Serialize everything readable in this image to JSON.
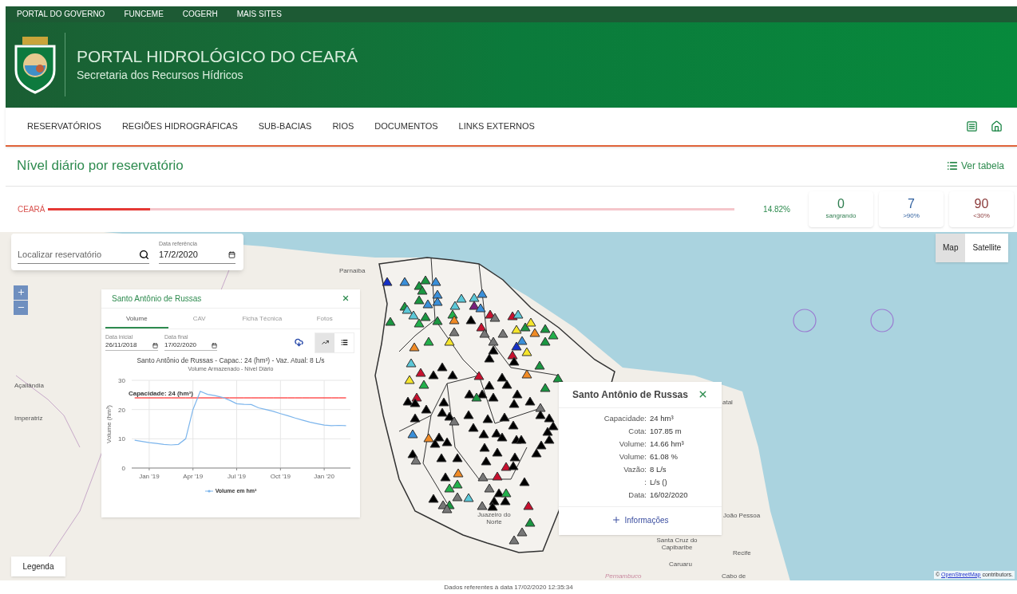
{
  "top_links": [
    "PORTAL DO GOVERNO",
    "FUNCEME",
    "COGERH",
    "MAIS SITES"
  ],
  "header": {
    "title": "PORTAL HIDROLÓGICO DO CEARÁ",
    "subtitle": "Secretaria dos Recursos Hídricos"
  },
  "nav": {
    "items": [
      "RESERVATÓRIOS",
      "REGIÕES HIDROGRÁFICAS",
      "SUB-BACIAS",
      "RIOS",
      "DOCUMENTOS",
      "LINKS EXTERNOS"
    ]
  },
  "page_title": "Nível diário por reservatório",
  "table_link": "Ver tabela",
  "summary": {
    "region": "CEARÁ",
    "level": 0.1482,
    "reading": "14.82%",
    "cards": [
      {
        "value": "0",
        "label": "sangrando",
        "color": "#2e7d4f"
      },
      {
        "value": "7",
        "label": ">90%",
        "color": "#2f5f9e"
      },
      {
        "value": "90",
        "label": "<30%",
        "color": "#8b3a3a"
      }
    ]
  },
  "map": {
    "search": {
      "placeholder": "Localizar reservatório"
    },
    "date": {
      "label": "Data referência",
      "value": "17/2/2020"
    },
    "map_types": [
      {
        "label": "Map",
        "selected": true
      },
      {
        "label": "Satellite",
        "selected": false
      }
    ],
    "labels": [
      "Parnaíba",
      "Açailândia",
      "Imperatriz",
      "atal",
      "João Pessoa",
      "Santa Cruz do Capibaribe",
      "Recife",
      "Caruaru",
      "Cabo de",
      "Pernambuco",
      "Juazeiro do Norte"
    ],
    "markers": [
      {
        "color": "#1530c8"
      },
      {
        "color": "#3a8fd9"
      },
      {
        "color": "#1a9641"
      },
      {
        "color": "#1a9641"
      },
      {
        "color": "#3a8fd9"
      },
      {
        "color": "#1a9641"
      },
      {
        "color": "#3a8fd9"
      },
      {
        "color": "#1a9641"
      },
      {
        "color": "#5bc8d8"
      },
      {
        "color": "#1a9641"
      },
      {
        "color": "#3a8fd9"
      },
      {
        "color": "#3a8fd9"
      },
      {
        "color": "#5bc8d8"
      },
      {
        "color": "#1a9641"
      },
      {
        "color": "#1a9641"
      },
      {
        "color": "#1a9641"
      },
      {
        "color": "#22b04b"
      },
      {
        "color": "#22b04b"
      },
      {
        "color": "#f08a24"
      },
      {
        "color": "#5bc8d8"
      },
      {
        "color": "#5bc8d8"
      },
      {
        "color": "#5bc8d8"
      },
      {
        "color": "#3a8fd9"
      },
      {
        "color": "#7a1f7a"
      },
      {
        "color": "#3a8fd9"
      },
      {
        "color": "#000000"
      },
      {
        "color": "#c8102e"
      },
      {
        "color": "#777777"
      },
      {
        "color": "#c8102e"
      },
      {
        "color": "#777777"
      },
      {
        "color": "#777777"
      },
      {
        "color": "#777777"
      },
      {
        "color": "#c8102e"
      },
      {
        "color": "#5bc8d8"
      },
      {
        "color": "#f5e52c"
      },
      {
        "color": "#1a9641"
      },
      {
        "color": "#f5e52c"
      },
      {
        "color": "#f08a24"
      },
      {
        "color": "#1a9641"
      },
      {
        "color": "#22b04b"
      },
      {
        "color": "#1a9641"
      },
      {
        "color": "#3a8fd9"
      },
      {
        "color": "#1530c8"
      },
      {
        "color": "#f5e52c"
      },
      {
        "color": "#777777"
      },
      {
        "color": "#000000"
      },
      {
        "color": "#000000"
      },
      {
        "color": "#c8102e"
      },
      {
        "color": "#000000"
      },
      {
        "color": "#22b04b"
      },
      {
        "color": "#f5e52c"
      },
      {
        "color": "#f08a24"
      },
      {
        "color": "#5bc8d8"
      },
      {
        "color": "#c8102e"
      },
      {
        "color": "#000000"
      },
      {
        "color": "#000000"
      },
      {
        "color": "#000000"
      },
      {
        "color": "#c8102e"
      },
      {
        "color": "#000000"
      },
      {
        "color": "#000000"
      },
      {
        "color": "#000000"
      },
      {
        "color": "#1a9641"
      },
      {
        "color": "#f08a24"
      },
      {
        "color": "#1a9641"
      },
      {
        "color": "#1a9641"
      },
      {
        "color": "#f5e52c"
      },
      {
        "color": "#22b04b"
      },
      {
        "color": "#000000"
      },
      {
        "color": "#c8102e"
      },
      {
        "color": "#000000"
      },
      {
        "color": "#000000"
      },
      {
        "color": "#000000"
      },
      {
        "color": "#000000"
      },
      {
        "color": "#1a9641"
      },
      {
        "color": "#000000"
      },
      {
        "color": "#000000"
      },
      {
        "color": "#000000"
      },
      {
        "color": "#000000"
      },
      {
        "color": "#000000"
      },
      {
        "color": "#000000"
      },
      {
        "color": "#000000"
      },
      {
        "color": "#777777"
      },
      {
        "color": "#000000"
      },
      {
        "color": "#000000"
      },
      {
        "color": "#000000"
      },
      {
        "color": "#000000"
      },
      {
        "color": "#000000"
      },
      {
        "color": "#777777"
      },
      {
        "color": "#000000"
      },
      {
        "color": "#000000"
      },
      {
        "color": "#000000"
      },
      {
        "color": "#000000"
      },
      {
        "color": "#000000"
      },
      {
        "color": "#000000"
      },
      {
        "color": "#000000"
      },
      {
        "color": "#000000"
      },
      {
        "color": "#000000"
      },
      {
        "color": "#000000"
      },
      {
        "color": "#000000"
      },
      {
        "color": "#000000"
      },
      {
        "color": "#3a8fd9"
      },
      {
        "color": "#f08a24"
      },
      {
        "color": "#000000"
      },
      {
        "color": "#000000"
      },
      {
        "color": "#000000"
      },
      {
        "color": "#000000"
      },
      {
        "color": "#000000"
      },
      {
        "color": "#000000"
      },
      {
        "color": "#000000"
      },
      {
        "color": "#000000"
      },
      {
        "color": "#777777"
      },
      {
        "color": "#000000"
      },
      {
        "color": "#000000"
      },
      {
        "color": "#000000"
      },
      {
        "color": "#c8102e"
      },
      {
        "color": "#000000"
      },
      {
        "color": "#f08a24"
      },
      {
        "color": "#000000"
      },
      {
        "color": "#777777"
      },
      {
        "color": "#c8102e"
      },
      {
        "color": "#000000"
      },
      {
        "color": "#22b04b"
      },
      {
        "color": "#22b04b"
      },
      {
        "color": "#777777"
      },
      {
        "color": "#000000"
      },
      {
        "color": "#22b04b"
      },
      {
        "color": "#000000"
      },
      {
        "color": "#777777"
      },
      {
        "color": "#5bc8d8"
      },
      {
        "color": "#000000"
      },
      {
        "color": "#000000"
      },
      {
        "color": "#000000"
      },
      {
        "color": "#777777"
      },
      {
        "color": "#777777"
      },
      {
        "color": "#1a9641"
      },
      {
        "color": "#777777"
      },
      {
        "color": "#c8102e"
      },
      {
        "color": "#777777"
      },
      {
        "color": "#777777"
      },
      {
        "color": "#1a9641"
      }
    ],
    "chart_popup": {
      "title": "Santo Antônio de Russas",
      "tabs": [
        {
          "label": "Volume",
          "selected": true
        },
        {
          "label": "CAV",
          "selected": false
        },
        {
          "label": "Ficha Técnica",
          "selected": false
        },
        {
          "label": "Fotos",
          "selected": false
        }
      ],
      "date_fields": [
        {
          "label": "Data inicial",
          "value": "26/11/2018"
        },
        {
          "label": "Data final",
          "value": "17/02/2020"
        }
      ],
      "view_buttons": [
        {
          "kind": "chart",
          "selected": true
        },
        {
          "kind": "table",
          "selected": false
        }
      ],
      "chart_data": {
        "type": "line",
        "title": "Santo Antônio de Russas - Capac.: 24 (hm³) - Vaz. Atual: 8 L/s",
        "subtitle": "Volume Armazenado - Nível Diário",
        "ylabel": "Volume (hm³)",
        "categories": [
          null,
          null,
          "Jan '19",
          null,
          null,
          null,
          null,
          null,
          "Apr '19",
          null,
          null,
          null,
          null,
          null,
          "Jul '19",
          null,
          null,
          null,
          null,
          null,
          "Oct '19",
          null,
          null,
          null,
          null,
          null,
          "Jan '20",
          null,
          null,
          null
        ],
        "series": [
          {
            "name": "Volume em hm³",
            "color": "#7cb5ec",
            "values": [
              9.5,
              9.1,
              8.7,
              8.4,
              8.1,
              7.9,
              8.1,
              10.0,
              20,
              26.2,
              25.2,
              24.8,
              24.2,
              23.2,
              22,
              21.8,
              21.7,
              20.6,
              20,
              19.4,
              18.6,
              17.9,
              17.1,
              16.4,
              15.7,
              15.2,
              14.7,
              14.5,
              14.6,
              14.5
            ]
          },
          {
            "name": "Capacidade: 24 (hm³)",
            "color": "#ff0000",
            "values": [
              24,
              24,
              24,
              24,
              24,
              24,
              24,
              24,
              24,
              24,
              24,
              24,
              24,
              24,
              24,
              24,
              24,
              24,
              24,
              24,
              24,
              24,
              24,
              24,
              24,
              24,
              24,
              24,
              24,
              24
            ]
          }
        ],
        "ylim": [
          0,
          30
        ],
        "yticks": [
          0,
          10,
          20,
          30
        ],
        "grid": true
      }
    },
    "info_popup": {
      "title": "Santo Antônio de Russas",
      "rows": [
        {
          "label": "Capacidade:",
          "value": "24 hm³"
        },
        {
          "label": "Cota:",
          "value": "107.85 m"
        },
        {
          "label": "Volume:",
          "value": "14.66 hm³"
        },
        {
          "label": "Volume:",
          "value": "61.08 %"
        },
        {
          "label": "Vazão:",
          "value": "8 L/s"
        },
        {
          "label": ":",
          "value": "L/s ()"
        },
        {
          "label": "Data:",
          "value": "16/02/2020"
        }
      ],
      "more": "Informações"
    },
    "legend_button": "Legenda",
    "attribution": {
      "prefix": "©",
      "link": "OpenStreetMap",
      "suffix": "contributors."
    }
  },
  "footer": "Dados referentes à data 17/02/2020 12:35:34"
}
